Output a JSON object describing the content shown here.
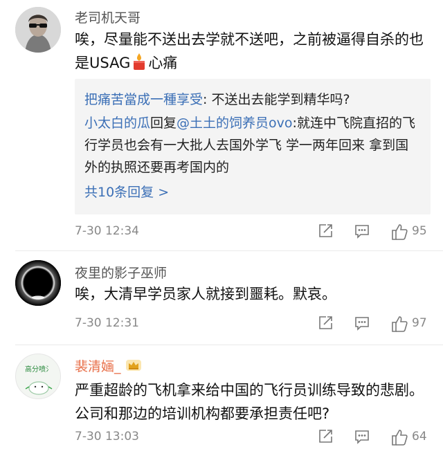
{
  "comments": [
    {
      "username": "老司机天哥",
      "text_before_icon": "唉，尽量能不送出去学就不送吧，之前被逼得自杀的也是USAG",
      "text_after_icon": "心痛",
      "inline_icon": "candle-icon",
      "replies": [
        {
          "user": "把痛苦當成一種享受",
          "sep": ": ",
          "body": "不送出去能学到精华吗?"
        },
        {
          "user": "小太白的瓜",
          "action": "回复",
          "mention": "@土土的饲养员ovo",
          "sep": ":",
          "body": "就连中飞院直招的飞行学员也会有一大批人去国外学飞 学一两年回来 拿到国外的执照还要再考国内的"
        }
      ],
      "more_replies": "共10条回复 >",
      "time": "7-30 12:34",
      "likes": "95"
    },
    {
      "username": "夜里的影子巫师",
      "text": "唉，大清早学员家人就接到噩耗。默哀。",
      "time": "7-30 12:31",
      "likes": "97"
    },
    {
      "username": "裴清婳_",
      "badge": "crown-badge-icon",
      "avatar_text": "高分喷氵",
      "text": "严重超龄的飞机拿来给中国的飞行员训练导致的悲剧。公司和那边的培训机构都要承担责任吧?",
      "time": "7-30 13:03",
      "likes": "64"
    }
  ],
  "colors": {
    "link": "#3b6fb6",
    "vip_name": "#e8704a",
    "meta": "#888888",
    "reply_bg": "#f4f4f4"
  }
}
